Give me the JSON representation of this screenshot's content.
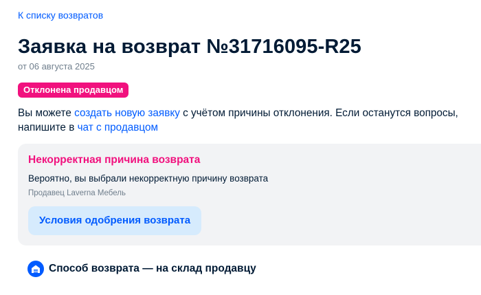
{
  "nav": {
    "back_label": "К списку возвратов"
  },
  "header": {
    "title": "Заявка на возврат №31716095-R25",
    "date": "от 06 августа 2025",
    "status": "Отклонена продавцом"
  },
  "info": {
    "part1": "Вы можете ",
    "link_new_request": "создать новую заявку",
    "part2": " с учётом причины отклонения. Если останутся вопросы,",
    "part3": "напишите в ",
    "link_chat": "чат с продавцом"
  },
  "reason": {
    "title": "Некорректная причина возврата",
    "description": "Вероятно, вы выбрали некорректную причину возврата",
    "seller": "Продавец Laverna Мебель",
    "button_label": "Условия одобрения возврата"
  },
  "method": {
    "icon": "warehouse-icon",
    "label": "Способ возврата — на склад продавцу"
  },
  "colors": {
    "accent": "#005bff",
    "status": "#f1117e",
    "card_bg": "#f2f3f5",
    "button_bg": "#d6ebfd"
  }
}
